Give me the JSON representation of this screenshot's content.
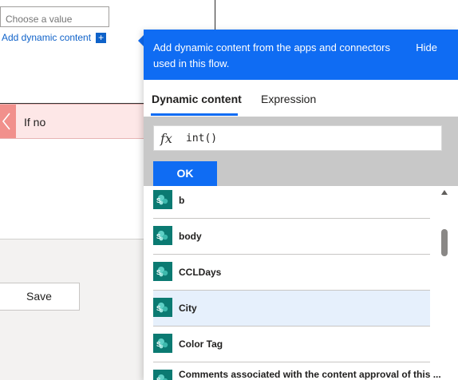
{
  "background": {
    "choose_placeholder": "Choose a value",
    "add_dynamic_content": "Add dynamic content",
    "add_icon": "+",
    "if_no_label": "If no",
    "save_label": "Save"
  },
  "panel": {
    "header_text": "Add dynamic content from the apps and connectors used in this flow.",
    "hide_label": "Hide",
    "tabs": [
      {
        "label": "Dynamic content",
        "active": true
      },
      {
        "label": "Expression",
        "active": false
      }
    ],
    "expression": {
      "fx_label": "fx",
      "value": "int()"
    },
    "ok_label": "OK",
    "items": [
      {
        "label": "b",
        "icon": "sharepoint-icon"
      },
      {
        "label": "body",
        "icon": "sharepoint-icon"
      },
      {
        "label": "CCLDays",
        "icon": "sharepoint-icon"
      },
      {
        "label": "City",
        "icon": "sharepoint-icon",
        "selected": true
      },
      {
        "label": "Color Tag",
        "icon": "sharepoint-icon"
      },
      {
        "label": "Comments associated with the content approval of this ...",
        "icon": "sharepoint-icon"
      }
    ]
  },
  "colors": {
    "accent": "#0f6cf3",
    "sharepoint": "#0b7a72",
    "if_no_bg": "#fde7e7",
    "if_no_tab": "#f1908c",
    "selected_row": "#e6f0fc"
  }
}
